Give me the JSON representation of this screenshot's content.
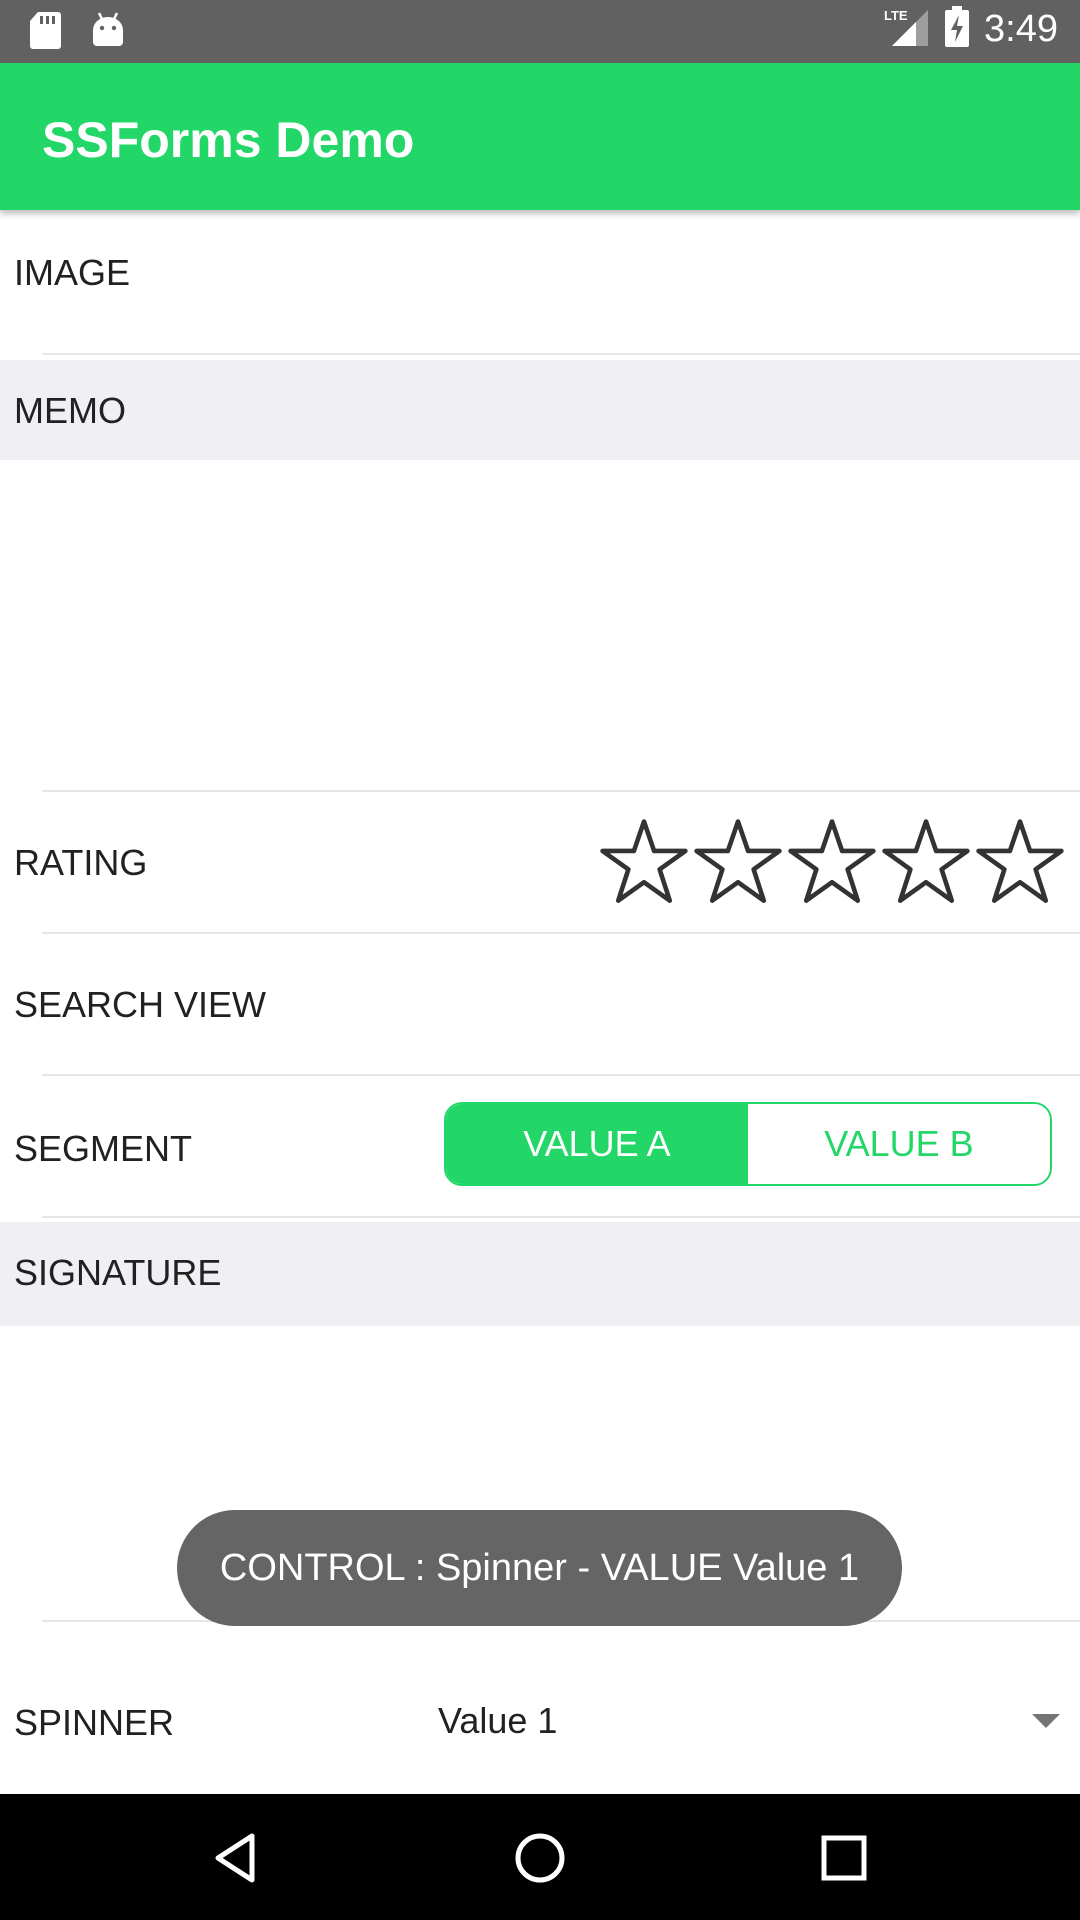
{
  "status_bar": {
    "time": "3:49",
    "network": "LTE",
    "icons": [
      "sd-card-icon",
      "android-icon",
      "signal-icon",
      "battery-charging-icon"
    ]
  },
  "app_bar": {
    "title": "SSForms Demo"
  },
  "form": {
    "image_label": "IMAGE",
    "memo_section": "MEMO",
    "rating_label": "RATING",
    "rating_value": 0,
    "rating_max": 5,
    "search_view_label": "SEARCH VIEW",
    "segment_label": "SEGMENT",
    "segment_options": [
      "VALUE A",
      "VALUE B"
    ],
    "segment_selected": "VALUE A",
    "signature_section": "SIGNATURE",
    "spinner_label": "SPINNER",
    "spinner_value": "Value 1"
  },
  "toast": {
    "message": "CONTROL : Spinner - VALUE Value 1"
  },
  "colors": {
    "accent": "#22d667",
    "status_bar": "#616161",
    "section_bg": "#efeff4",
    "toast_bg": "#656565"
  },
  "nav_bar": {
    "icons": [
      "back-icon",
      "home-icon",
      "recents-icon"
    ]
  }
}
